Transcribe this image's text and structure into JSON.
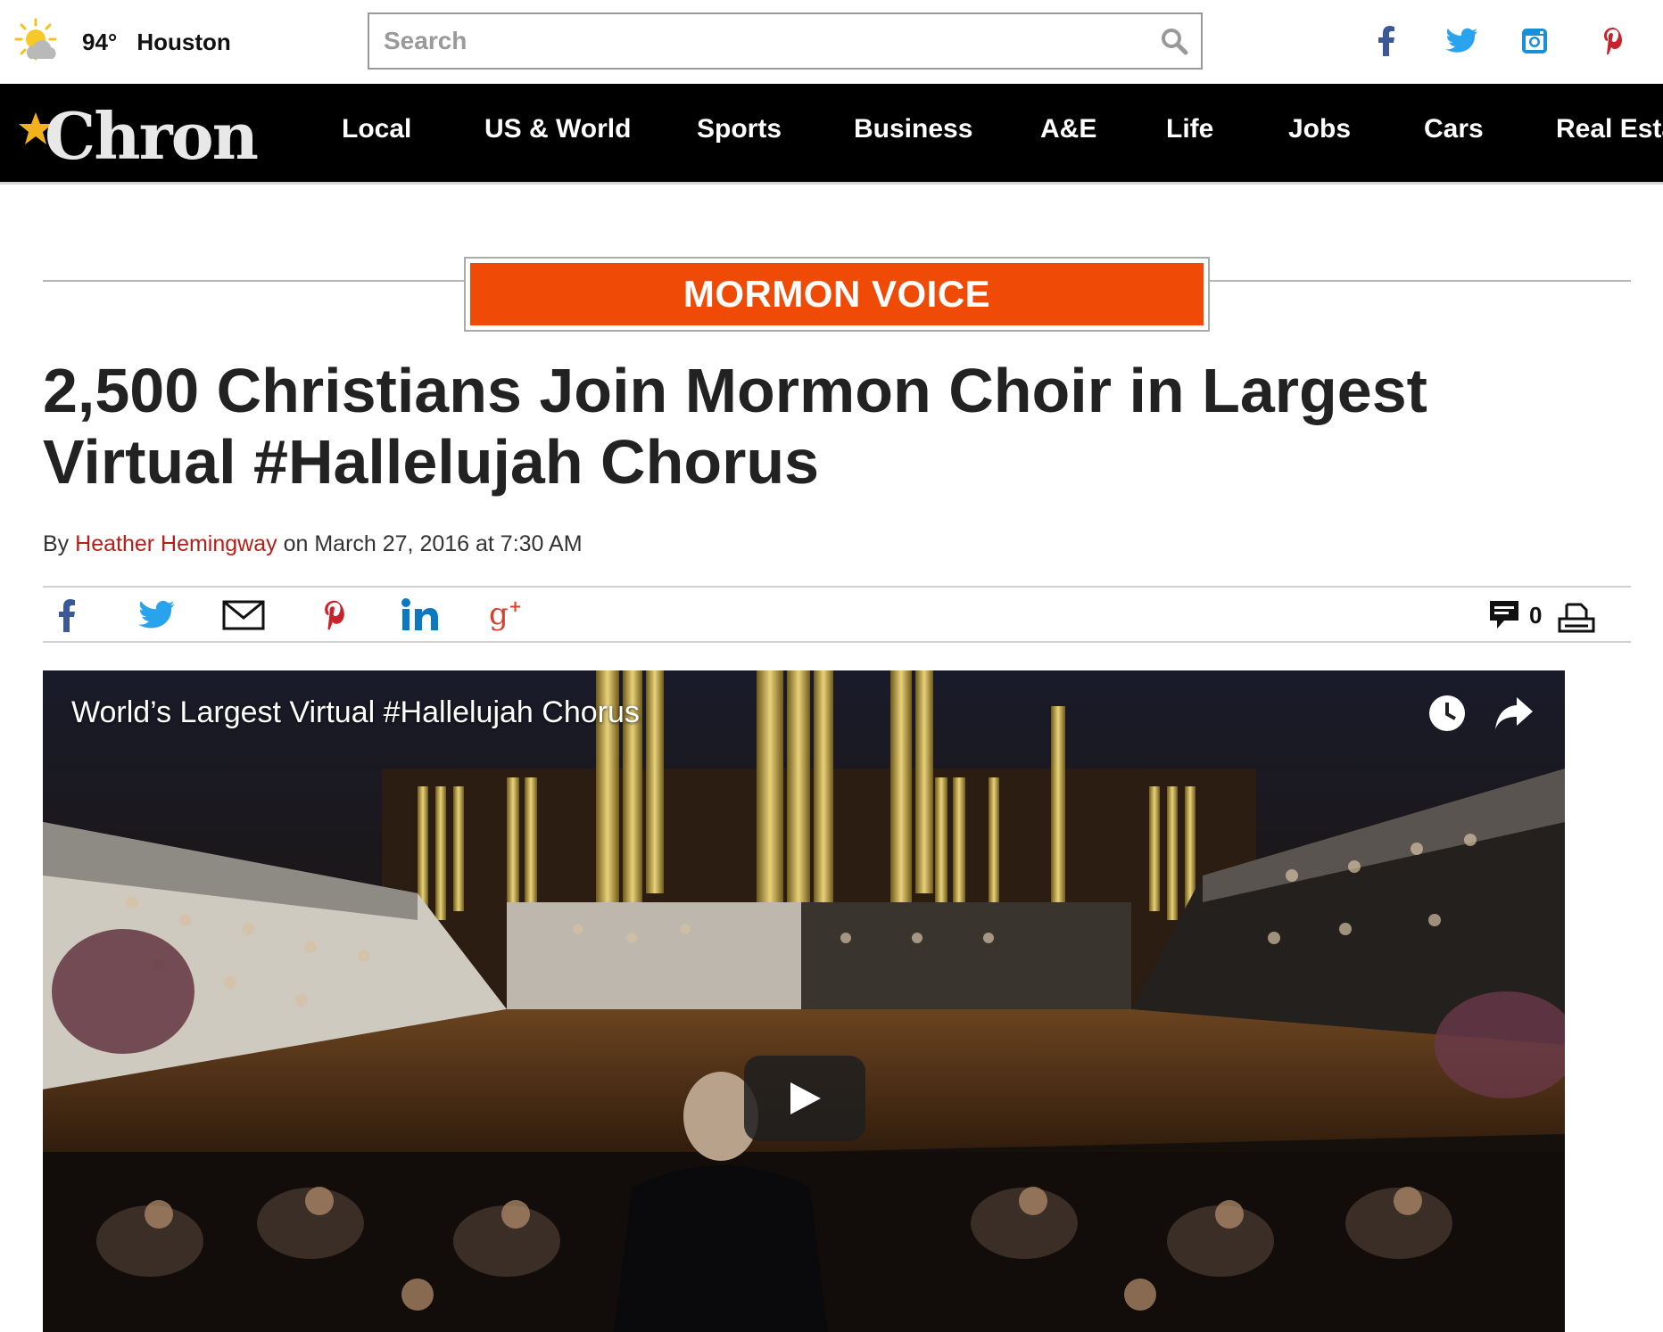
{
  "weather": {
    "temp": "94°",
    "city": "Houston",
    "icon": "partly-sunny-icon"
  },
  "search": {
    "placeholder": "Search",
    "icon": "search-icon"
  },
  "social_links": [
    {
      "name": "facebook-icon",
      "color": "#3b5998"
    },
    {
      "name": "twitter-icon",
      "color": "#1da1f2"
    },
    {
      "name": "instagram-icon",
      "color": "#1a8fd9"
    },
    {
      "name": "pinterest-icon",
      "color": "#c8232c"
    }
  ],
  "nav": {
    "logo": "Chron",
    "items": [
      "Local",
      "US & World",
      "Sports",
      "Business",
      "A&E",
      "Life",
      "Jobs",
      "Cars",
      "Real Esta"
    ]
  },
  "article": {
    "section": "MORMON VOICE",
    "section_color": "#ef4b07",
    "headline": "2,500 Christians Join Mormon Choir in Largest Virtual #Hallelujah Chorus",
    "byline_prefix": "By",
    "author": "Heather Hemingway",
    "byline_suffix": "on March 27, 2016 at 7:30 AM"
  },
  "share_bar": {
    "icons": [
      "facebook-icon",
      "twitter-icon",
      "email-icon",
      "pinterest-icon",
      "linkedin-icon",
      "google-plus-icon"
    ],
    "comment_count": "0",
    "print_icon": "print-icon"
  },
  "video": {
    "title": "World’s Largest Virtual #Hallelujah Chorus",
    "controls": [
      "watch-later-icon",
      "share-icon",
      "play-icon"
    ]
  }
}
